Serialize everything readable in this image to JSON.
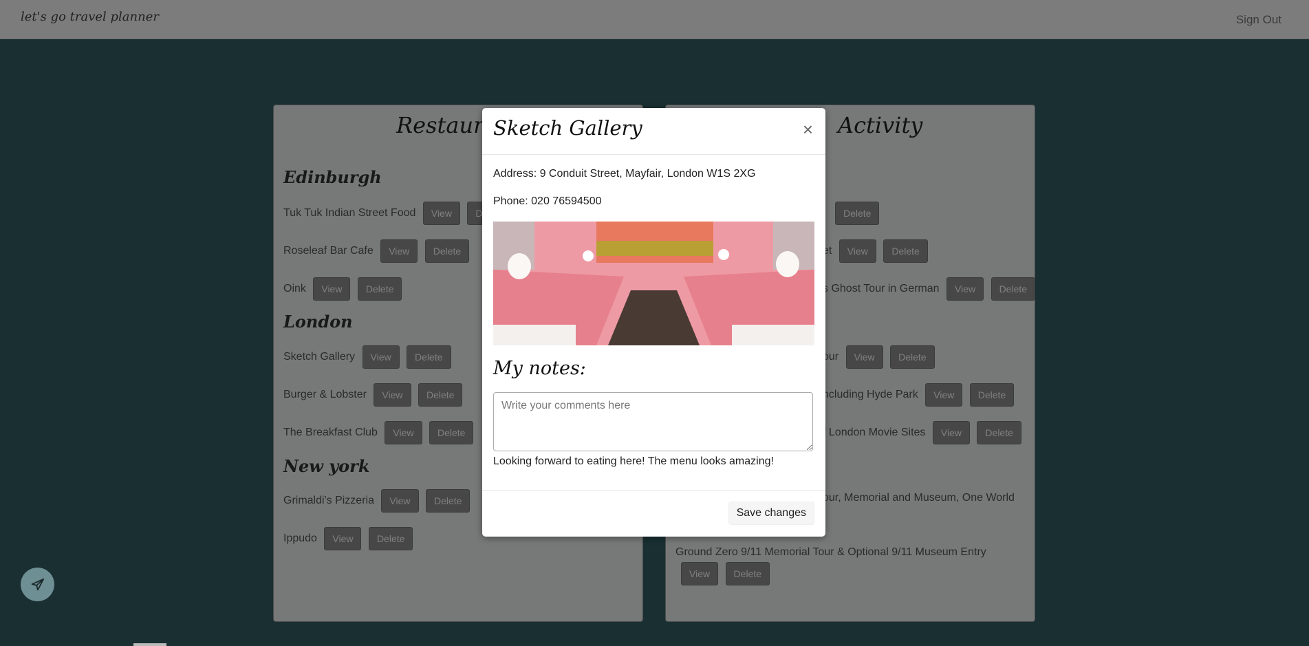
{
  "navbar": {
    "brand": "let's go travel planner",
    "sign_out": "Sign Out"
  },
  "buttons": {
    "view": "View",
    "delete": "Delete"
  },
  "restaurants": {
    "title": "Restaurant",
    "groups": [
      {
        "city": "Edinburgh",
        "items": [
          "Tuk Tuk Indian Street Food",
          "Roseleaf Bar Cafe",
          "Oink"
        ]
      },
      {
        "city": "London",
        "items": [
          "Sketch Gallery",
          "Burger & Lobster",
          "The Breakfast Club"
        ]
      },
      {
        "city": "New york",
        "items": [
          "Grimaldi's Pizzeria",
          "Ippudo"
        ]
      }
    ]
  },
  "activities": {
    "title": "Activity",
    "visible_rows": [
      "et",
      "s Ghost Tour in German",
      "our",
      "ncluding Hyde Park",
      "f London Movie Sites",
      "our, Memorial and Museum, One World",
      "Ground Zero 9/11 Memorial Tour & Optional 9/11 Museum Entry"
    ]
  },
  "modal": {
    "title": "Sketch Gallery",
    "close": "×",
    "address": "Address: 9 Conduit Street, Mayfair, London W1S 2XG",
    "phone": "Phone: 020 76594500",
    "notes_label": "My notes:",
    "comments_placeholder": "Write your comments here",
    "note": "Looking forward to eating here! The menu looks amazing!",
    "save": "Save changes"
  },
  "colors": {
    "background": "#335f65",
    "button": "#8f8f8f"
  }
}
